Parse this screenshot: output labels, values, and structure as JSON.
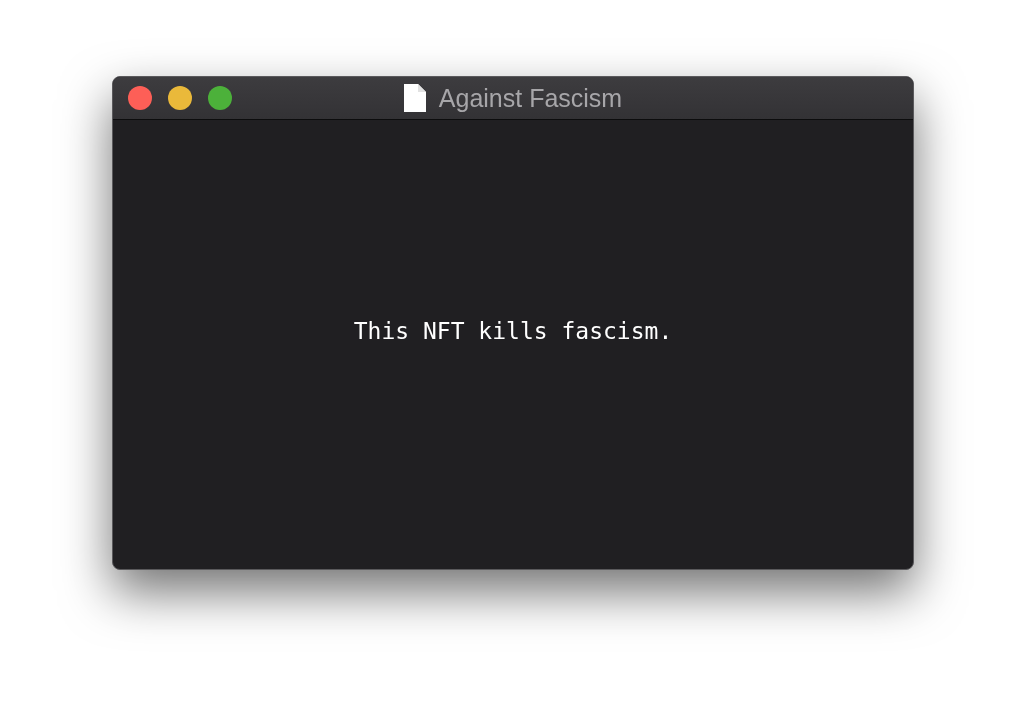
{
  "window": {
    "title": "Against Fascism"
  },
  "content": {
    "text": "This NFT kills fascism."
  }
}
